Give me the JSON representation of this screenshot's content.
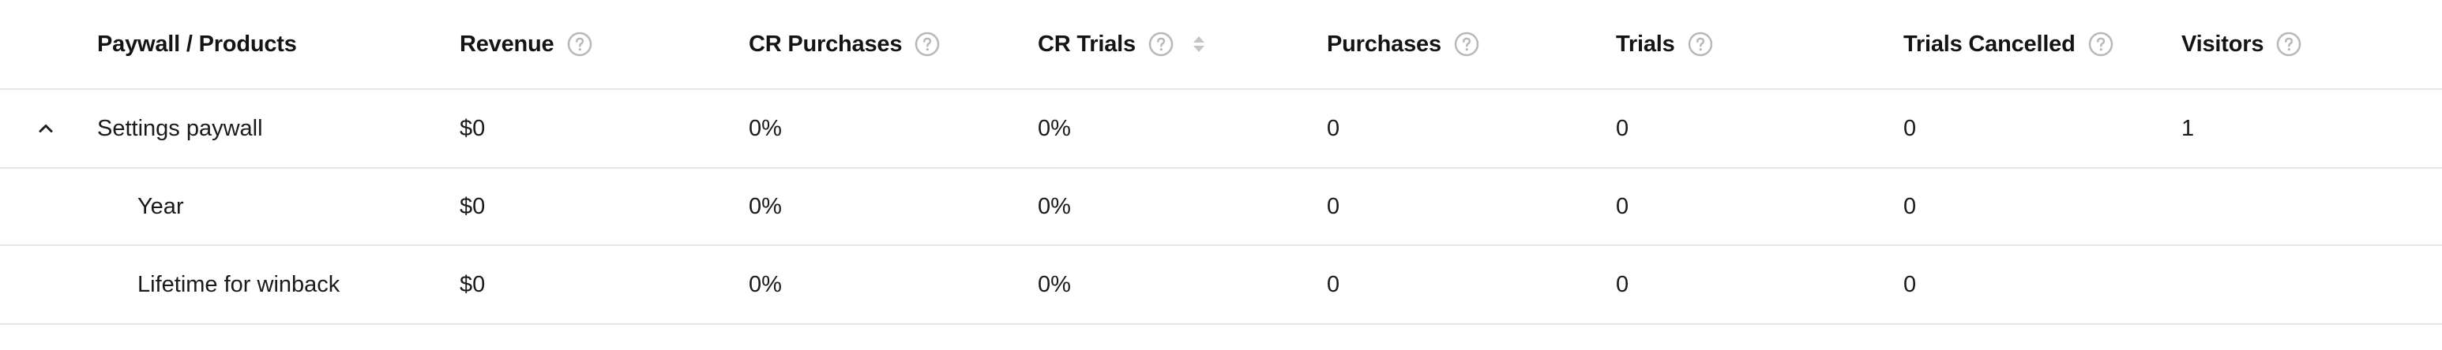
{
  "table": {
    "headers": {
      "name": "Paywall / Products",
      "revenue": "Revenue",
      "cr_purchases": "CR Purchases",
      "cr_trials": "CR Trials",
      "purchases": "Purchases",
      "trials": "Trials",
      "trials_cancelled": "Trials Cancelled",
      "visitors": "Visitors"
    },
    "rows": [
      {
        "name": "Settings paywall",
        "revenue": "$0",
        "cr_purchases": "0%",
        "cr_trials": "0%",
        "purchases": "0",
        "trials": "0",
        "trials_cancelled": "0",
        "visitors": "1"
      },
      {
        "name": "Year",
        "revenue": "$0",
        "cr_purchases": "0%",
        "cr_trials": "0%",
        "purchases": "0",
        "trials": "0",
        "trials_cancelled": "0",
        "visitors": ""
      },
      {
        "name": "Lifetime for winback",
        "revenue": "$0",
        "cr_purchases": "0%",
        "cr_trials": "0%",
        "purchases": "0",
        "trials": "0",
        "trials_cancelled": "0",
        "visitors": ""
      }
    ]
  },
  "icons": {
    "help": "help-circle-icon",
    "sort": "sort-icon",
    "collapse": "chevron-up-icon"
  },
  "colors": {
    "text": "#1a1a1a",
    "header_text": "#141414",
    "icon_gray": "#b8b8b8",
    "divider": "#e6e6e6"
  }
}
